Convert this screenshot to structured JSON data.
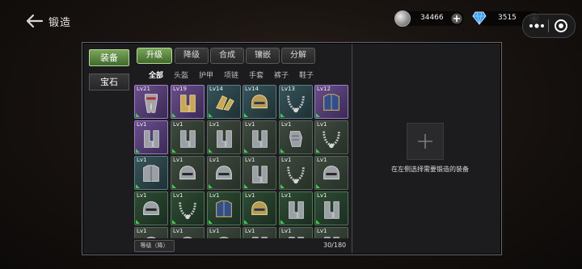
{
  "header": {
    "title": "锻造",
    "coins": "34466",
    "gems": "3515"
  },
  "sidebar": {
    "tabs": [
      "装备",
      "宝石"
    ]
  },
  "operations": [
    "升级",
    "降级",
    "合成",
    "镶嵌",
    "分解"
  ],
  "filters": [
    "全部",
    "头盔",
    "护甲",
    "项链",
    "手套",
    "裤子",
    "鞋子"
  ],
  "grid": {
    "items": [
      {
        "lv": "Lv21",
        "rarity": "purple",
        "icon": "armor-leg-icon"
      },
      {
        "lv": "Lv19",
        "rarity": "purple",
        "icon": "boots-gold-icon"
      },
      {
        "lv": "Lv14",
        "rarity": "teal",
        "icon": "gauntlet-gold-icon"
      },
      {
        "lv": "Lv14",
        "rarity": "teal",
        "icon": "helmet-gold-icon"
      },
      {
        "lv": "Lv13",
        "rarity": "teal",
        "icon": "necklace-icon"
      },
      {
        "lv": "Lv12",
        "rarity": "purple",
        "icon": "chest-armor-blue-icon"
      },
      {
        "lv": "Lv1",
        "rarity": "purple",
        "icon": "boots-icon"
      },
      {
        "lv": "Lv1",
        "rarity": "gray",
        "icon": "boots-icon"
      },
      {
        "lv": "Lv1",
        "rarity": "gray",
        "icon": "boots-icon"
      },
      {
        "lv": "Lv1",
        "rarity": "gray",
        "icon": "boots-icon"
      },
      {
        "lv": "Lv1",
        "rarity": "gray",
        "icon": "gauntlet-icon"
      },
      {
        "lv": "Lv1",
        "rarity": "gray",
        "icon": "necklace-icon"
      },
      {
        "lv": "Lv1",
        "rarity": "teal",
        "icon": "chest-armor-icon"
      },
      {
        "lv": "Lv1",
        "rarity": "gray",
        "icon": "helmet-icon"
      },
      {
        "lv": "Lv1",
        "rarity": "gray",
        "icon": "helmet-icon"
      },
      {
        "lv": "Lv1",
        "rarity": "gray",
        "icon": "boots-icon"
      },
      {
        "lv": "Lv1",
        "rarity": "gray",
        "icon": "necklace-icon"
      },
      {
        "lv": "Lv1",
        "rarity": "gray",
        "icon": "helmet-icon"
      },
      {
        "lv": "Lv1",
        "rarity": "green",
        "icon": "helmet-icon"
      },
      {
        "lv": "Lv1",
        "rarity": "green",
        "icon": "necklace-icon"
      },
      {
        "lv": "Lv1",
        "rarity": "green",
        "icon": "chest-armor-blue-icon"
      },
      {
        "lv": "Lv1",
        "rarity": "green",
        "icon": "helmet-gold-icon"
      },
      {
        "lv": "Lv1",
        "rarity": "green",
        "icon": "boots-icon"
      },
      {
        "lv": "Lv1",
        "rarity": "green",
        "icon": "boots-icon"
      },
      {
        "lv": "Lv1",
        "rarity": "gray",
        "icon": "helmet-icon"
      },
      {
        "lv": "Lv1",
        "rarity": "gray",
        "icon": "helmet-icon"
      },
      {
        "lv": "Lv1",
        "rarity": "gray",
        "icon": "helmet-icon"
      },
      {
        "lv": "Lv1",
        "rarity": "gray",
        "icon": "boots-icon"
      },
      {
        "lv": "Lv1",
        "rarity": "gray",
        "icon": "boots-icon"
      },
      {
        "lv": "Lv1",
        "rarity": "gray",
        "icon": "boots-icon"
      }
    ]
  },
  "footer": {
    "sort_label": "等级（降）",
    "count": "30/180"
  },
  "detail": {
    "hint": "在左侧选择需要锻造的装备"
  }
}
